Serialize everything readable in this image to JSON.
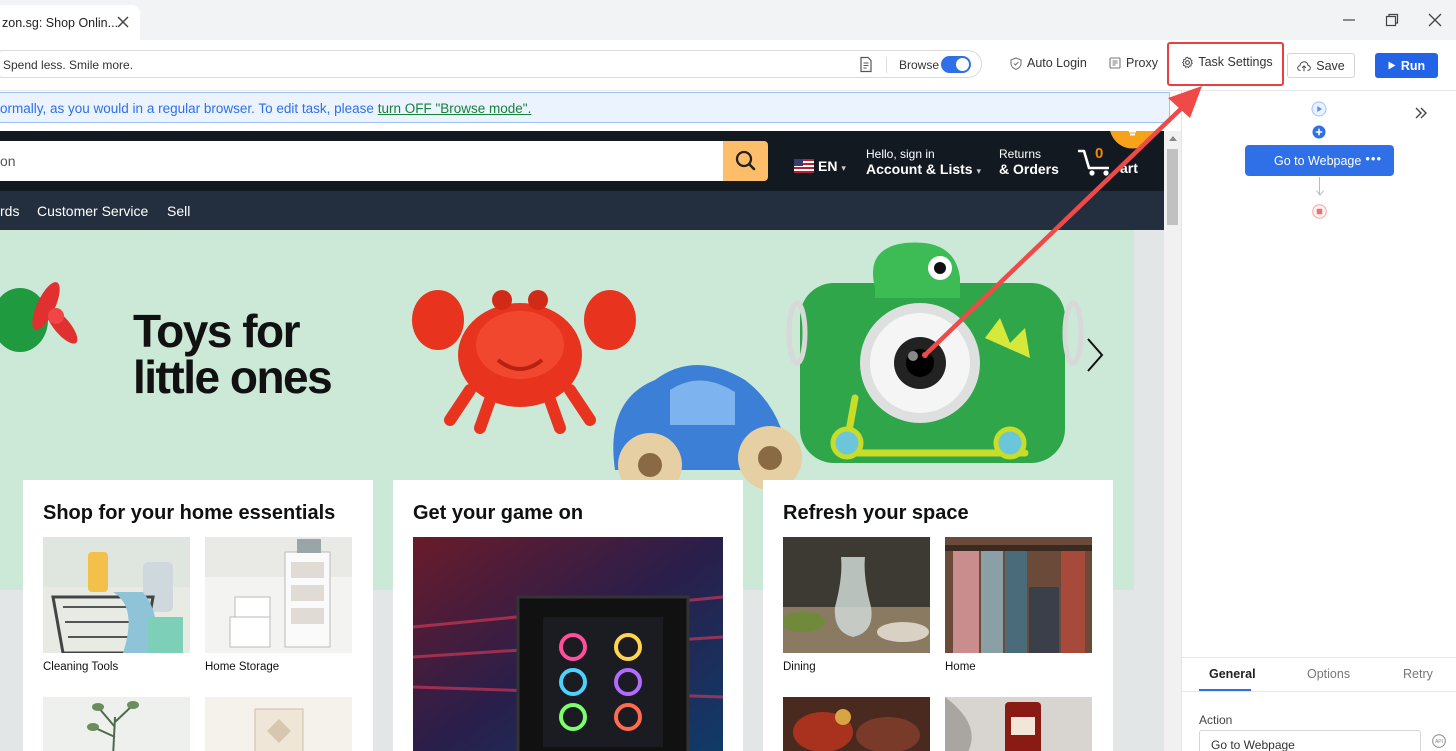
{
  "window": {
    "tab_title": "zon.sg: Shop Onlin..."
  },
  "toolbar": {
    "url": "Spend less. Smile more.",
    "browse_label": "Browse",
    "browse_on": true,
    "auto_login_label": "Auto Login",
    "proxy_label": "Proxy",
    "task_settings_label": "Task Settings",
    "save_label": "Save",
    "run_label": "Run"
  },
  "notice": {
    "text": "ormally, as you would in a regular browser. To edit task, please ",
    "link": "turn OFF \"Browse mode\"."
  },
  "webpage": {
    "search_placeholder": "on",
    "language": "EN",
    "account_line1": "Hello, sign in",
    "account_line2": "Account & Lists",
    "returns_line1": "Returns",
    "returns_line2": "& Orders",
    "cart_count": "0",
    "cart_label": "art",
    "subnav": [
      "rds",
      "Customer Service",
      "Sell"
    ],
    "hero_title_line1": "Toys for",
    "hero_title_line2": "little ones",
    "cards": [
      {
        "title": "Shop for your home essentials",
        "tiles": [
          {
            "label": "Cleaning Tools"
          },
          {
            "label": "Home Storage"
          }
        ]
      },
      {
        "title": "Get your game on",
        "tiles": []
      },
      {
        "title": "Refresh your space",
        "tiles": [
          {
            "label": "Dining"
          },
          {
            "label": "Home"
          }
        ]
      }
    ]
  },
  "right_panel": {
    "flow_node_label": "Go to Webpage",
    "tabs": [
      "General",
      "Options",
      "Retry"
    ],
    "active_tab": "General",
    "action_label": "Action",
    "action_value": "Go to Webpage"
  },
  "colors": {
    "accent": "#2f6fe8",
    "highlight": "#e8403e",
    "amazon_dark": "#131921",
    "amazon_nav": "#232f3e",
    "search_button": "#febd69",
    "hero_bg": "#cce8d6"
  }
}
